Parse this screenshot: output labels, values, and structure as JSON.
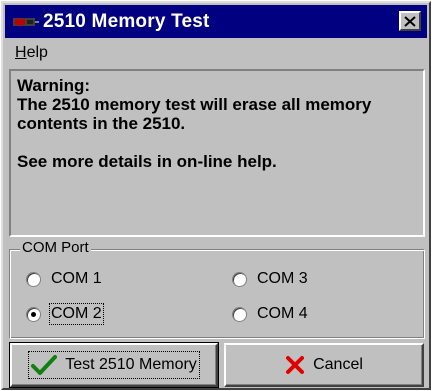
{
  "window": {
    "title": "2510 Memory Test"
  },
  "menu": {
    "help": "Help",
    "help_accel": "H",
    "help_rest": "elp"
  },
  "warning": {
    "line1": "Warning:",
    "line2": "The 2510 memory test will erase all memory contents in the 2510.",
    "line3": "See more details in on-line help."
  },
  "com_port": {
    "label": "COM Port",
    "options": [
      {
        "label": "COM 1",
        "checked": false
      },
      {
        "label": "COM 2",
        "checked": true
      },
      {
        "label": "COM 3",
        "checked": false
      },
      {
        "label": "COM 4",
        "checked": false
      }
    ]
  },
  "buttons": {
    "test": "Test 2510 Memory",
    "cancel": "Cancel"
  },
  "icons": {
    "app": "app-icon",
    "close": "close-icon",
    "check": "checkmark-icon",
    "cancel": "x-icon"
  },
  "colors": {
    "titlebar": "#000080",
    "face": "#c0c0c0",
    "check_green": "#108010",
    "cancel_red": "#e00000"
  }
}
